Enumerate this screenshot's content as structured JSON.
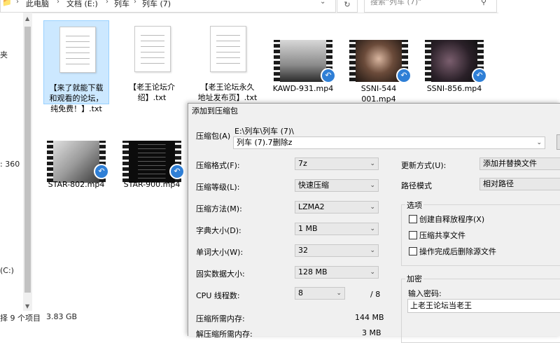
{
  "explorer": {
    "breadcrumb": [
      "此电脑",
      "文档 (E:)",
      "列车",
      "列车 (7)"
    ],
    "refresh_icon": "refresh-icon",
    "search_placeholder": "搜索\"列车 (7)\"",
    "nav_items": [
      "夹",
      ": 360",
      "(C:)"
    ],
    "status_count": "择 9 个项目",
    "status_size": "3.83 GB",
    "files": [
      {
        "name": "【来了就能下载和观看的论坛，纯免费！】.txt",
        "kind": "txt"
      },
      {
        "name": "【老王论坛介绍】.txt",
        "kind": "txt"
      },
      {
        "name": "【老王论坛永久地址发布页】.txt",
        "kind": "txt"
      },
      {
        "name": "KAWD-931.mp4",
        "kind": "mp4"
      },
      {
        "name": "SSNI-544001.mp4",
        "kind": "mp4"
      },
      {
        "name": "SSNI-856.mp4",
        "kind": "mp4"
      },
      {
        "name": "STAR-802.mp4",
        "kind": "mp4"
      },
      {
        "name": "STAR-900.mp4",
        "kind": "mp4"
      }
    ],
    "file_lines": [
      [
        "【来了就能下载",
        "和观看的论坛，",
        "纯免费！】.txt"
      ],
      [
        "【老王论坛介",
        "绍】.txt"
      ],
      [
        "【老王论坛永久",
        "地址发布页】.txt"
      ],
      [
        "KAWD-931.mp4"
      ],
      [
        "SSNI-544",
        "001.mp4"
      ],
      [
        "SSNI-856.mp4"
      ],
      [
        "STAR-802.mp4"
      ],
      [
        "STAR-900.mp4"
      ]
    ]
  },
  "dialog": {
    "title": "添加到压缩包",
    "archive_label": "压缩包(A)",
    "archive_path": "E:\\列车\\列车 (7)\\",
    "archive_name": "列车 (7).7删除z",
    "format_label": "压缩格式(F):",
    "format_value": "7z",
    "level_label": "压缩等级(L):",
    "level_value": "快速压缩",
    "method_label": "压缩方法(M):",
    "method_value": "LZMA2",
    "dict_label": "字典大小(D):",
    "dict_value": "1 MB",
    "word_label": "单词大小(W):",
    "word_value": "32",
    "solid_label": "固实数据大小:",
    "solid_value": "128 MB",
    "cpu_label": "CPU 线程数:",
    "cpu_value": "8",
    "cpu_total": "/ 8",
    "mem_comp_label": "压缩所需内存:",
    "mem_comp_value": "144 MB",
    "mem_decomp_label": "解压缩所需内存:",
    "mem_decomp_value": "3 MB",
    "update_label": "更新方式(U):",
    "update_value": "添加并替换文件",
    "path_label": "路径模式",
    "path_value": "相对路径",
    "options_label": "选项",
    "opt_sfx": "创建自释放程序(X)",
    "opt_shared": "压缩共享文件",
    "opt_delete": "操作完成后删除源文件",
    "encrypt_label": "加密",
    "password_label": "输入密码:",
    "password_value": "上老王论坛当老王"
  }
}
